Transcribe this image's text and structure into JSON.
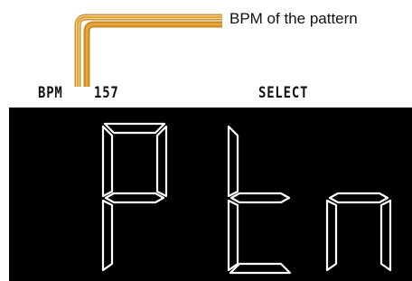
{
  "callout": {
    "text": "BPM of the pattern",
    "color": "#E8A63A"
  },
  "status_bar": {
    "bpm_label": "BPM",
    "bpm_value": "157",
    "mode": "SELECT"
  },
  "display": {
    "text": "Ptn",
    "background": "#000000",
    "segment_color": "#FFFFFF"
  }
}
